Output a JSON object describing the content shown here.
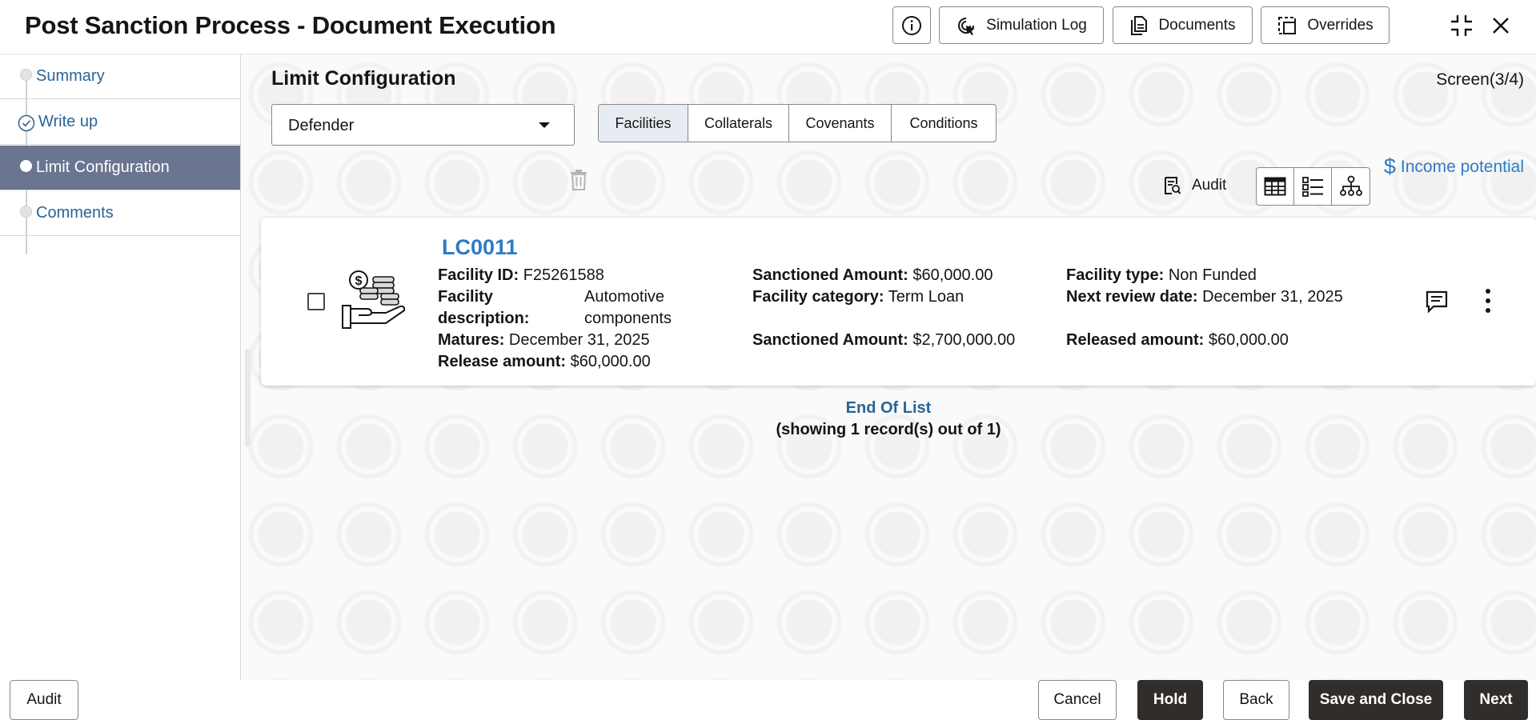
{
  "header": {
    "title": "Post Sanction Process - Document Execution",
    "info_icon": "info-icon",
    "buttons": {
      "simulation_log": "Simulation Log",
      "documents": "Documents",
      "overrides": "Overrides"
    }
  },
  "sidebar": {
    "items": [
      {
        "label": "Summary",
        "state": "default"
      },
      {
        "label": "Write up",
        "state": "completed"
      },
      {
        "label": "Limit Configuration",
        "state": "active"
      },
      {
        "label": "Comments",
        "state": "default"
      }
    ]
  },
  "main": {
    "title": "Limit Configuration",
    "screen": "Screen(3/4)",
    "dropdown_value": "Defender",
    "tabs": [
      "Facilities",
      "Collaterals",
      "Covenants",
      "Conditions"
    ],
    "selected_tab": "Facilities",
    "income_potential": "Income potential",
    "audit": "Audit",
    "end_of_list": "End Of List",
    "record_summary": "(showing 1 record(s) out of 1)"
  },
  "card": {
    "title": "LC0011",
    "facility_id_label": "Facility ID:",
    "facility_id": "F25261588",
    "facility_desc_label_1": "Facility",
    "facility_desc_label_2": "description:",
    "facility_desc_1": "Automotive",
    "facility_desc_2": "components",
    "matures_label": "Matures:",
    "matures": "December 31, 2025",
    "release_amount_label": "Release amount:",
    "release_amount": "$60,000.00",
    "sanctioned_amount_label": "Sanctioned Amount:",
    "sanctioned_amount": "$60,000.00",
    "facility_category_label": "Facility category:",
    "facility_category": "Term Loan",
    "sanctioned_amount_2_label": "Sanctioned Amount:",
    "sanctioned_amount_2": "$2,700,000.00",
    "facility_type_label": "Facility type:",
    "facility_type": "Non Funded",
    "next_review_label": "Next review date:",
    "next_review": "December 31, 2025",
    "released_amount_label": "Released amount:",
    "released_amount": "$60,000.00"
  },
  "footer": {
    "audit": "Audit",
    "cancel": "Cancel",
    "hold": "Hold",
    "back": "Back",
    "save_close": "Save and Close",
    "next": "Next"
  },
  "colors": {
    "accent_blue": "#2e7bc4",
    "nav_active": "#6b7590",
    "dark_button": "#312d2a"
  }
}
